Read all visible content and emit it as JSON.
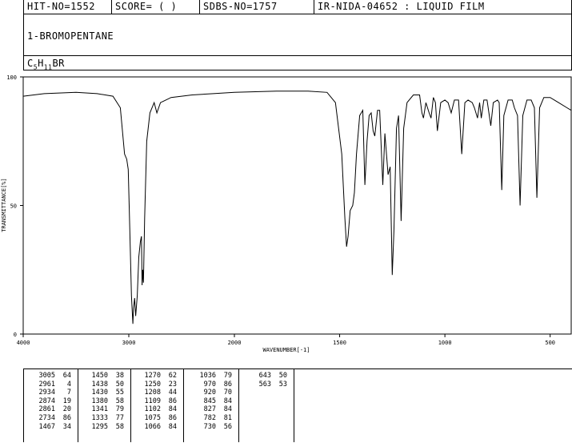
{
  "header": {
    "hit_no": "HIT-NO=1552",
    "score": "SCORE=  (   )",
    "sdbs_no": "SDBS-NO=1757",
    "ir_info": "IR-NIDA-04652 : LIQUID FILM"
  },
  "compound": {
    "name": "1-BROMOPENTANE",
    "formula_parts": [
      {
        "t": "C",
        "sub": false
      },
      {
        "t": "5",
        "sub": true
      },
      {
        "t": "H",
        "sub": false
      },
      {
        "t": "11",
        "sub": true
      },
      {
        "t": "BR",
        "sub": false
      }
    ]
  },
  "chart_data": {
    "type": "line",
    "xlabel": "WAVENUMBER[-1]",
    "ylabel": "TRANSMITTANCE[%]",
    "xlim": [
      4000,
      400
    ],
    "ylim": [
      0,
      100
    ],
    "x_ticks": [
      4000,
      3000,
      2000,
      1500,
      1000,
      500
    ],
    "y_ticks": [
      0,
      50,
      100
    ],
    "spectrum": [
      [
        4000,
        92.5
      ],
      [
        3800,
        93.5
      ],
      [
        3500,
        94
      ],
      [
        3300,
        93.5
      ],
      [
        3150,
        92.5
      ],
      [
        3080,
        88
      ],
      [
        3040,
        70
      ],
      [
        3020,
        68
      ],
      [
        3005,
        64
      ],
      [
        2990,
        40
      ],
      [
        2975,
        15
      ],
      [
        2961,
        4
      ],
      [
        2955,
        10
      ],
      [
        2945,
        14
      ],
      [
        2935,
        7
      ],
      [
        2920,
        15
      ],
      [
        2905,
        30
      ],
      [
        2890,
        36
      ],
      [
        2880,
        38
      ],
      [
        2874,
        19
      ],
      [
        2868,
        25
      ],
      [
        2861,
        20
      ],
      [
        2850,
        45
      ],
      [
        2830,
        75
      ],
      [
        2800,
        86
      ],
      [
        2760,
        90
      ],
      [
        2734,
        86
      ],
      [
        2700,
        90
      ],
      [
        2650,
        91
      ],
      [
        2600,
        92
      ],
      [
        2400,
        93
      ],
      [
        2200,
        93.5
      ],
      [
        2000,
        94
      ],
      [
        1800,
        94.5
      ],
      [
        1650,
        94.5
      ],
      [
        1560,
        94
      ],
      [
        1520,
        90
      ],
      [
        1490,
        70
      ],
      [
        1475,
        45
      ],
      [
        1467,
        34
      ],
      [
        1460,
        38
      ],
      [
        1450,
        48
      ],
      [
        1438,
        50
      ],
      [
        1430,
        55
      ],
      [
        1420,
        70
      ],
      [
        1405,
        85
      ],
      [
        1390,
        87
      ],
      [
        1380,
        58
      ],
      [
        1370,
        75
      ],
      [
        1360,
        85
      ],
      [
        1350,
        86
      ],
      [
        1341,
        79
      ],
      [
        1333,
        77
      ],
      [
        1320,
        87
      ],
      [
        1310,
        87
      ],
      [
        1295,
        58
      ],
      [
        1285,
        78
      ],
      [
        1270,
        62
      ],
      [
        1260,
        65
      ],
      [
        1250,
        23
      ],
      [
        1242,
        40
      ],
      [
        1230,
        80
      ],
      [
        1220,
        85
      ],
      [
        1208,
        44
      ],
      [
        1196,
        80
      ],
      [
        1180,
        90
      ],
      [
        1150,
        93
      ],
      [
        1120,
        93
      ],
      [
        1109,
        86
      ],
      [
        1102,
        84
      ],
      [
        1090,
        90
      ],
      [
        1075,
        86
      ],
      [
        1066,
        84
      ],
      [
        1055,
        92
      ],
      [
        1045,
        90
      ],
      [
        1036,
        79
      ],
      [
        1020,
        90
      ],
      [
        1000,
        91
      ],
      [
        985,
        90
      ],
      [
        970,
        86
      ],
      [
        955,
        91
      ],
      [
        935,
        91
      ],
      [
        920,
        70
      ],
      [
        905,
        90
      ],
      [
        890,
        91
      ],
      [
        870,
        90
      ],
      [
        860,
        88
      ],
      [
        845,
        84
      ],
      [
        835,
        90
      ],
      [
        827,
        84
      ],
      [
        815,
        91
      ],
      [
        800,
        91
      ],
      [
        782,
        81
      ],
      [
        770,
        90
      ],
      [
        750,
        91
      ],
      [
        742,
        90
      ],
      [
        730,
        56
      ],
      [
        720,
        85
      ],
      [
        700,
        91
      ],
      [
        680,
        91
      ],
      [
        670,
        88
      ],
      [
        655,
        85
      ],
      [
        643,
        50
      ],
      [
        630,
        85
      ],
      [
        610,
        91
      ],
      [
        590,
        91
      ],
      [
        575,
        88
      ],
      [
        563,
        53
      ],
      [
        550,
        88
      ],
      [
        530,
        92
      ],
      [
        500,
        92
      ],
      [
        460,
        90
      ],
      [
        420,
        88
      ],
      [
        400,
        87
      ]
    ],
    "peaks": [
      [
        [
          3005,
          64
        ],
        [
          2961,
          4
        ],
        [
          2934,
          7
        ],
        [
          2874,
          19
        ],
        [
          2861,
          20
        ],
        [
          2734,
          86
        ],
        [
          1467,
          34
        ]
      ],
      [
        [
          1450,
          38
        ],
        [
          1438,
          50
        ],
        [
          1430,
          55
        ],
        [
          1380,
          58
        ],
        [
          1341,
          79
        ],
        [
          1333,
          77
        ],
        [
          1295,
          58
        ]
      ],
      [
        [
          1270,
          62
        ],
        [
          1250,
          23
        ],
        [
          1208,
          44
        ],
        [
          1109,
          86
        ],
        [
          1102,
          84
        ],
        [
          1075,
          86
        ],
        [
          1066,
          84
        ]
      ],
      [
        [
          1036,
          79
        ],
        [
          970,
          86
        ],
        [
          920,
          70
        ],
        [
          845,
          84
        ],
        [
          827,
          84
        ],
        [
          782,
          81
        ],
        [
          730,
          56
        ]
      ],
      [
        [
          643,
          50
        ],
        [
          563,
          53
        ]
      ]
    ]
  }
}
